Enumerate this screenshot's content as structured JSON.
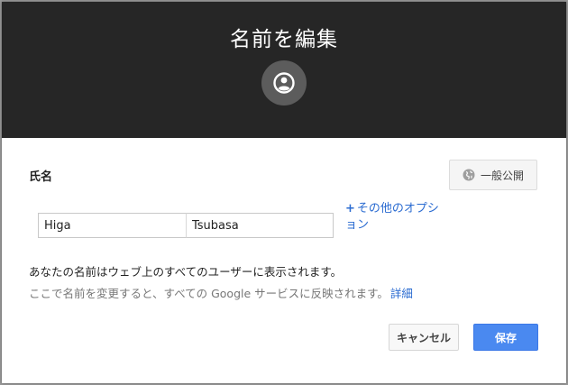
{
  "dialog": {
    "title": "名前を編集",
    "avatar_icon": "person-circle-icon"
  },
  "form": {
    "name_label": "氏名",
    "visibility": {
      "icon": "globe-icon",
      "label": "一般公開"
    },
    "last_name": {
      "value": "Higa",
      "placeholder": ""
    },
    "first_name": {
      "value": "Tsubasa",
      "placeholder": ""
    },
    "more_options": {
      "plus": "+",
      "label": "その他のオプション"
    },
    "info_text": "あなたの名前はウェブ上のすべてのユーザーに表示されます。",
    "sub_text": "ここで名前を変更すると、すべての Google サービスに反映されます。",
    "details_link": "詳細"
  },
  "actions": {
    "cancel_label": "キャンセル",
    "save_label": "保存"
  },
  "colors": {
    "header_bg": "#262626",
    "accent": "#4a89f0",
    "link": "#2a6bd1"
  }
}
